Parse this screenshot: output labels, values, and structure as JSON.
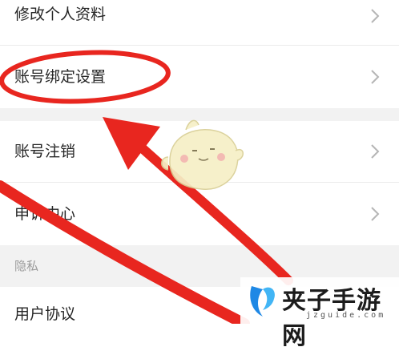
{
  "settings": {
    "items": [
      {
        "label": "修改个人资料"
      },
      {
        "label": "账号绑定设置"
      },
      {
        "label": "账号注销"
      },
      {
        "label": "申诉中心"
      }
    ],
    "privacy_section": {
      "title": "隐私",
      "items": [
        {
          "label": "用户协议"
        }
      ]
    }
  },
  "annotation": {
    "color": "#e8261f"
  },
  "watermark": {
    "name": "夹子手游网",
    "domain": "jzguide.com"
  }
}
